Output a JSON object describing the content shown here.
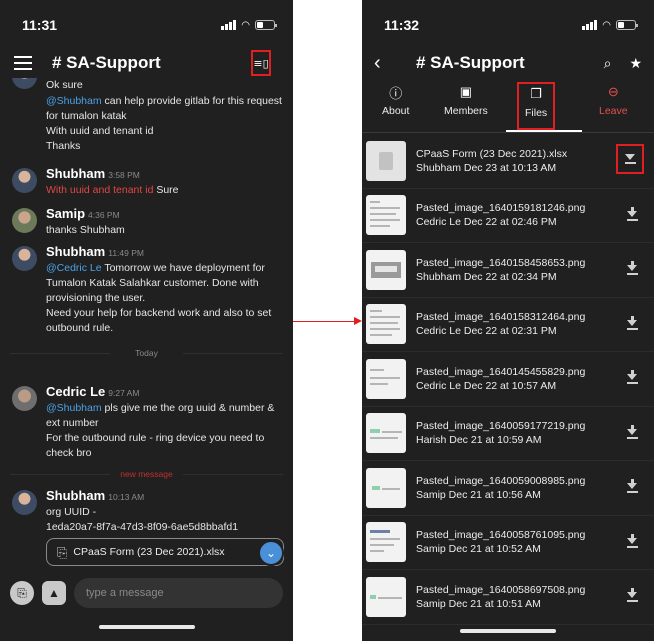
{
  "left": {
    "status_time": "11:31",
    "channel_title": "# SA-Support",
    "messages": [
      {
        "lines": [
          "Ok sure"
        ],
        "partial": true
      },
      {
        "lines": [
          "@Shubham can help provide gitlab for this request",
          "for tumalon katak",
          "With uuid and tenant id",
          "Thanks"
        ],
        "mention": "@Shubham",
        "after": " can help provide gitlab for this request"
      },
      {
        "name": "Shubham",
        "time": "3:58 PM",
        "red": "With uuid and tenant id",
        "after": " Sure"
      },
      {
        "name": "Samip",
        "time": "4:36 PM",
        "line": "thanks Shubham"
      },
      {
        "name": "Shubham",
        "time": "11:49 PM",
        "mention": "@Cedric Le",
        "after": " Tomorrow we have deployment for",
        "lines": [
          "Tumalon Katak Salahkar customer. Done with",
          "provisioning the user.",
          "Need your help for backend work and also to set",
          "outbound rule."
        ]
      },
      {
        "name": "Cedric Le",
        "time": "9:27 AM",
        "mention": "@Shubham",
        "after": " pls give me the org uuid & number &",
        "lines": [
          "ext number",
          "For the outbound rule - ring device you need to",
          "check bro"
        ]
      },
      {
        "name": "Shubham",
        "time": "10:13 AM",
        "lines": [
          "org UUID -",
          "1eda20a7-8f7a-47d3-8f09-6ae5d8bbafd1"
        ]
      }
    ],
    "divider_today": "Today",
    "divider_new": "new message",
    "attachment": "CPaaS Form (23 Dec 2021).xlsx",
    "compose_placeholder": "type a message"
  },
  "right": {
    "status_time": "11:32",
    "channel_title": "# SA-Support",
    "tabs": [
      {
        "label": "About",
        "icon": "info-icon"
      },
      {
        "label": "Members",
        "icon": "members-icon"
      },
      {
        "label": "Files",
        "icon": "files-icon"
      },
      {
        "label": "Leave",
        "icon": "leave-icon"
      }
    ],
    "files": [
      {
        "name": "CPaaS Form (23 Dec 2021).xlsx",
        "meta": "Shubham Dec 23 at 10:13 AM"
      },
      {
        "name": "Pasted_image_1640159181246.png",
        "meta": "Cedric Le Dec 22 at 02:46 PM"
      },
      {
        "name": "Pasted_image_1640158458653.png",
        "meta": "Shubham Dec 22 at 02:34 PM"
      },
      {
        "name": "Pasted_image_1640158312464.png",
        "meta": "Cedric Le Dec 22 at 02:31 PM"
      },
      {
        "name": "Pasted_image_1640145455829.png",
        "meta": "Cedric Le Dec 22 at 10:57 AM"
      },
      {
        "name": "Pasted_image_1640059177219.png",
        "meta": "Harish Dec 21 at 10:59 AM"
      },
      {
        "name": "Pasted_image_1640059008985.png",
        "meta": "Samip Dec 21 at 10:56 AM"
      },
      {
        "name": "Pasted_image_1640058761095.png",
        "meta": "Samip Dec 21 at 10:52 AM"
      },
      {
        "name": "Pasted_image_1640058697508.png",
        "meta": "Samip Dec 21 at 10:51 AM"
      }
    ]
  },
  "colors": {
    "highlight": "#e02020",
    "mention": "#4ba2e8",
    "leave": "#e25050",
    "background": "#202020"
  }
}
